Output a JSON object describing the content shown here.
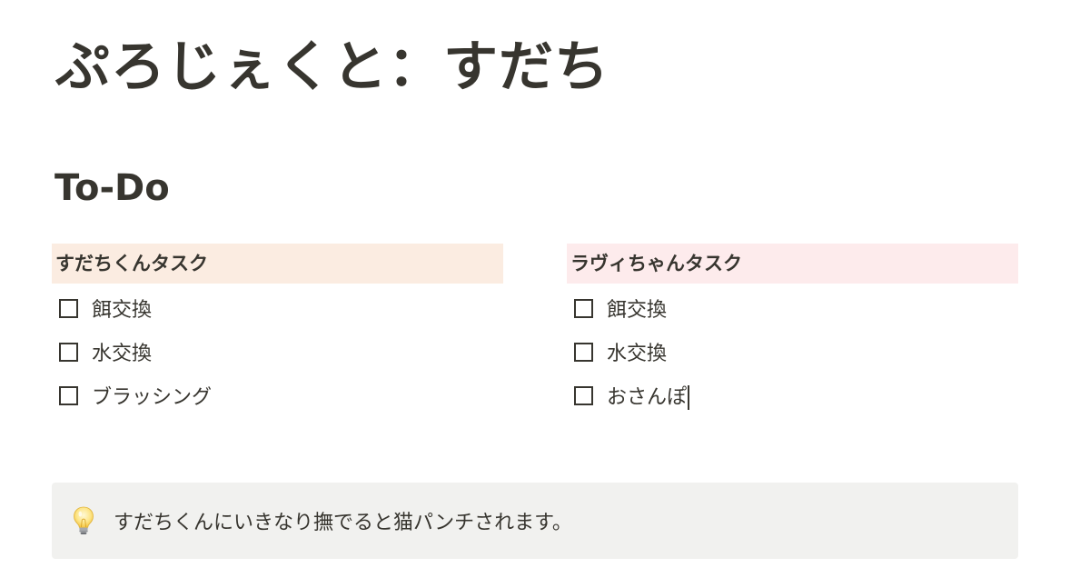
{
  "page": {
    "title": "ぷろじぇくと：すだち"
  },
  "todo_section": {
    "heading": "To-Do",
    "columns": [
      {
        "header": "すだちくんタスク",
        "header_color": "#fbece1",
        "items": [
          {
            "label": "餌交換",
            "checked": false
          },
          {
            "label": "水交換",
            "checked": false
          },
          {
            "label": "ブラッシング",
            "checked": false
          }
        ]
      },
      {
        "header": "ラヴィちゃんタスク",
        "header_color": "#fdebec",
        "items": [
          {
            "label": "餌交換",
            "checked": false
          },
          {
            "label": "水交換",
            "checked": false
          },
          {
            "label": "おさんぽ",
            "checked": false
          }
        ]
      }
    ]
  },
  "callout": {
    "icon": "lightbulb-icon",
    "text": "すだちくんにいきなり撫でると猫パンチされます。",
    "background": "#f1f1ef"
  },
  "colors": {
    "text": "#37352f",
    "background": "#ffffff"
  }
}
